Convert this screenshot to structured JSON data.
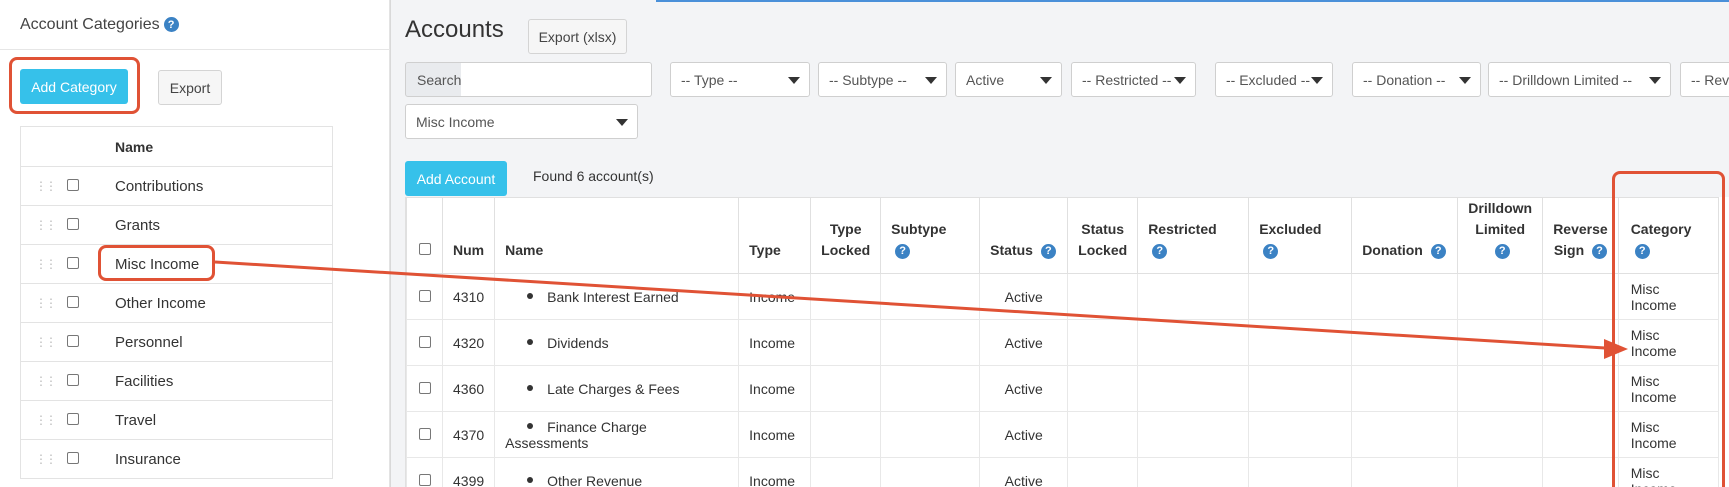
{
  "categories_panel": {
    "title": "Account Categories",
    "add_button": "Add Category",
    "export_button": "Export",
    "column_name": "Name",
    "items": [
      "Contributions",
      "Grants",
      "Misc Income",
      "Other Income",
      "Personnel",
      "Facilities",
      "Travel",
      "Insurance"
    ]
  },
  "accounts_panel": {
    "title": "Accounts",
    "export_button": "Export (xlsx)",
    "search_label": "Search",
    "search_value": "",
    "filters": {
      "type": "-- Type --",
      "subtype": "-- Subtype --",
      "status": "Active",
      "restricted": "-- Restricted --",
      "excluded": "-- Excluded --",
      "donation": "-- Donation --",
      "drilldown": "-- Drilldown Limited --",
      "reverse": "-- Rev",
      "category": "Misc Income"
    },
    "add_button": "Add Account",
    "found_text": "Found 6 account(s)",
    "columns": {
      "num": "Num",
      "name": "Name",
      "type": "Type",
      "type_locked_1": "Type",
      "type_locked_2": "Locked",
      "subtype": "Subtype",
      "status": "Status",
      "status_locked_1": "Status",
      "status_locked_2": "Locked",
      "restricted": "Restricted",
      "excluded": "Excluded",
      "donation": "Donation",
      "drilldown_1": "Drilldown",
      "drilldown_2": "Limited",
      "reverse_1": "Reverse",
      "reverse_2": "Sign",
      "category": "Category"
    },
    "rows": [
      {
        "num": "4310",
        "name": "Bank Interest Earned",
        "type": "Income",
        "status": "Active",
        "category": "Misc Income"
      },
      {
        "num": "4320",
        "name": "Dividends",
        "type": "Income",
        "status": "Active",
        "category": "Misc Income"
      },
      {
        "num": "4360",
        "name": "Late Charges & Fees",
        "type": "Income",
        "status": "Active",
        "category": "Misc Income"
      },
      {
        "num": "4370",
        "name": "Finance Charge Assessments",
        "type": "Income",
        "status": "Active",
        "category": "Misc Income"
      },
      {
        "num": "4399",
        "name": "Other Revenue",
        "type": "Income",
        "status": "Active",
        "category": "Misc Income"
      }
    ]
  },
  "colors": {
    "accent": "#36c1ea",
    "annotation": "#e05235",
    "help": "#3b82c4"
  }
}
